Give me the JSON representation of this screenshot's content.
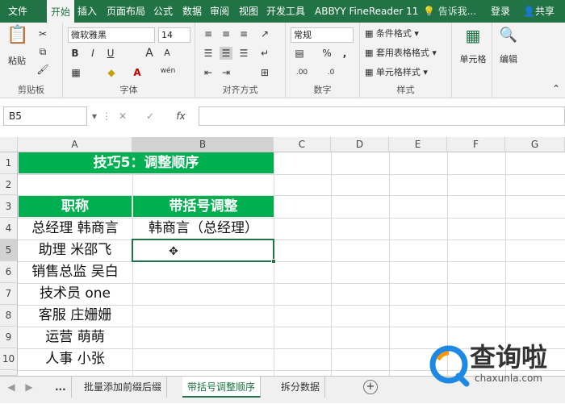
{
  "ribbon_tabs": [
    "文件",
    "开始",
    "插入",
    "页面布局",
    "公式",
    "数据",
    "审阅",
    "视图",
    "开发工具",
    "ABBYY FineReader 11",
    "告诉我...",
    "登录",
    "共享"
  ],
  "ribbon": {
    "clipboard": {
      "paste": "粘贴",
      "label": "剪贴板"
    },
    "font": {
      "name": "微软雅黑",
      "size": "14",
      "label": "字体",
      "bold": "B",
      "italic": "I",
      "underline": "U",
      "grow": "A",
      "shrink": "A",
      "wen": "wén"
    },
    "alignment": {
      "label": "对齐方式"
    },
    "number": {
      "format": "常规",
      "label": "数字",
      "percent": "%",
      "comma": ","
    },
    "styles": {
      "conditional": "条件格式",
      "table": "套用表格格式",
      "cell": "单元格样式",
      "label": "样式"
    },
    "cells": {
      "label": "单元格"
    },
    "editing": {
      "label": "编辑"
    }
  },
  "formula_bar": {
    "name_box": "B5",
    "fx": "fx",
    "value": ""
  },
  "columns": [
    "A",
    "B",
    "C",
    "D",
    "E",
    "F",
    "G"
  ],
  "rows": [
    "1",
    "2",
    "3",
    "4",
    "5",
    "6",
    "7",
    "8",
    "9",
    "10"
  ],
  "sheet": {
    "title": "技巧5：调整顺序",
    "header_a": "职称",
    "header_b": "带括号调整",
    "col_a": [
      "总经理 韩商言",
      "助理 米邵飞",
      "销售总监 吴白",
      "技术员 one",
      "客服 庄姗姗",
      "运营 萌萌",
      "人事 小张"
    ],
    "b4": "韩商言（总经理）"
  },
  "sheet_tabs": {
    "more": "...",
    "tabs": [
      "批量添加前缀后缀",
      "带括号调整顺序",
      "拆分数据"
    ],
    "add": "+"
  },
  "watermark": {
    "text": "查询啦",
    "sub": "chaxunla.com"
  },
  "colors": {
    "brand": "#217346",
    "header_fill": "#00b050"
  }
}
